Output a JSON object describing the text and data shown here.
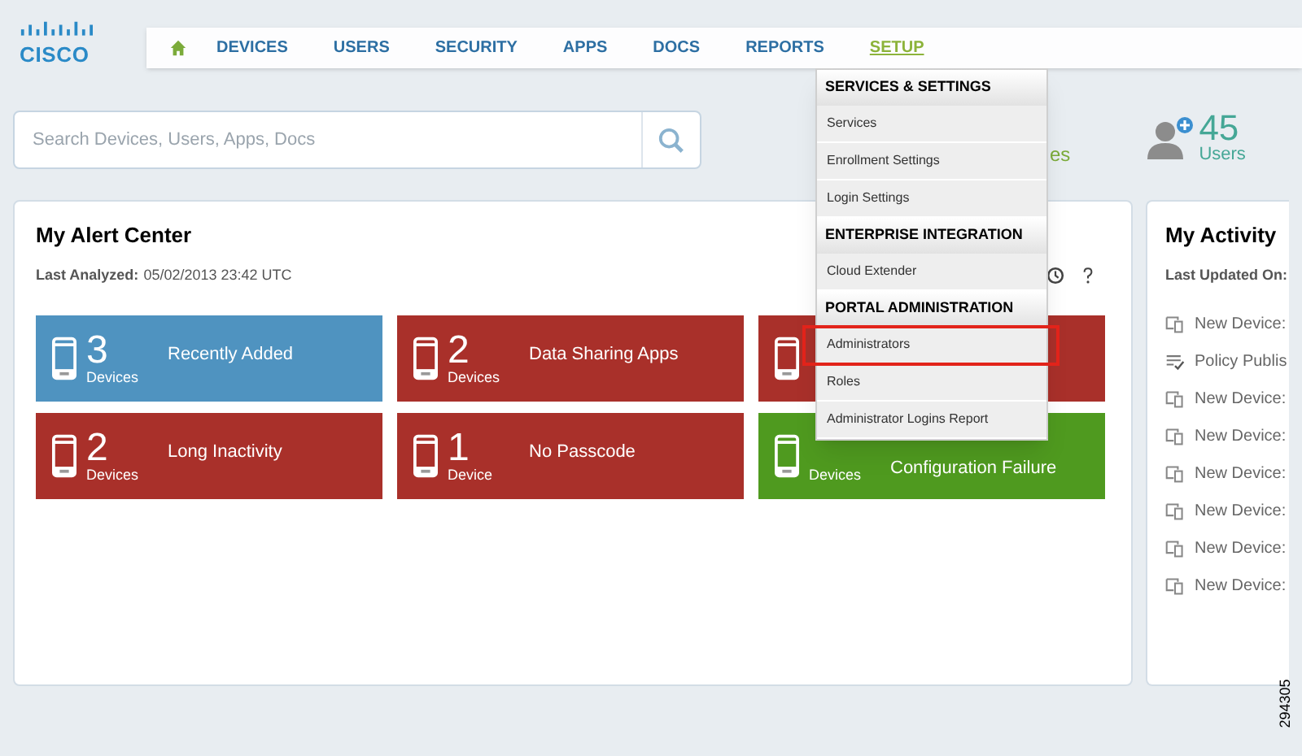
{
  "logo": {
    "text": "CISCO"
  },
  "nav": [
    {
      "label": "DEVICES",
      "selected": false
    },
    {
      "label": "USERS",
      "selected": false
    },
    {
      "label": "SECURITY",
      "selected": false
    },
    {
      "label": "APPS",
      "selected": false
    },
    {
      "label": "DOCS",
      "selected": false
    },
    {
      "label": "REPORTS",
      "selected": false
    },
    {
      "label": "SETUP",
      "selected": true
    }
  ],
  "search": {
    "placeholder": "Search Devices, Users, Apps, Docs"
  },
  "partial_stat": "es",
  "users_stat": {
    "count": "45",
    "label": "Users"
  },
  "setup_menu": [
    {
      "header": "SERVICES & SETTINGS",
      "items": [
        {
          "label": "Services",
          "highlighted": false
        },
        {
          "label": "Enrollment Settings",
          "highlighted": false
        },
        {
          "label": "Login Settings",
          "highlighted": false
        }
      ]
    },
    {
      "header": "ENTERPRISE INTEGRATION",
      "items": [
        {
          "label": "Cloud Extender",
          "highlighted": false
        }
      ]
    },
    {
      "header": "PORTAL ADMINISTRATION",
      "items": [
        {
          "label": "Administrators",
          "highlighted": true
        },
        {
          "label": "Roles",
          "highlighted": false
        },
        {
          "label": "Administrator Logins Report",
          "highlighted": false
        }
      ]
    }
  ],
  "alert_center": {
    "title": "My Alert Center",
    "last_analyzed_label": "Last Analyzed:",
    "last_analyzed": "05/02/2013 23:42 UTC",
    "tiles": [
      {
        "count": "3",
        "unit": "Devices",
        "label": "Recently Added",
        "color": "#4f93c0"
      },
      {
        "count": "2",
        "unit": "Devices",
        "label": "Data Sharing Apps",
        "color": "#a9302a"
      },
      {
        "color": "#a9302a"
      },
      {
        "count": "2",
        "unit": "Devices",
        "label": "Long Inactivity",
        "color": "#a9302a"
      },
      {
        "count": "1",
        "unit": "Device",
        "label": "No Passcode",
        "color": "#a9302a"
      },
      {
        "unit": "Devices",
        "label": "Configuration Failure",
        "color": "#4f9a1f"
      }
    ]
  },
  "activity": {
    "title": "My Activity",
    "last_updated_label": "Last Updated On:",
    "items": [
      {
        "kind": "device",
        "text": "New Device:"
      },
      {
        "kind": "policy",
        "text": "Policy Publis"
      },
      {
        "kind": "device",
        "text": "New Device:"
      },
      {
        "kind": "device",
        "text": "New Device:"
      },
      {
        "kind": "device",
        "text": "New Device:"
      },
      {
        "kind": "device",
        "text": "New Device:"
      },
      {
        "kind": "device",
        "text": "New Device:"
      },
      {
        "kind": "device",
        "text": "New Device:"
      }
    ]
  },
  "figure_number": "294305"
}
